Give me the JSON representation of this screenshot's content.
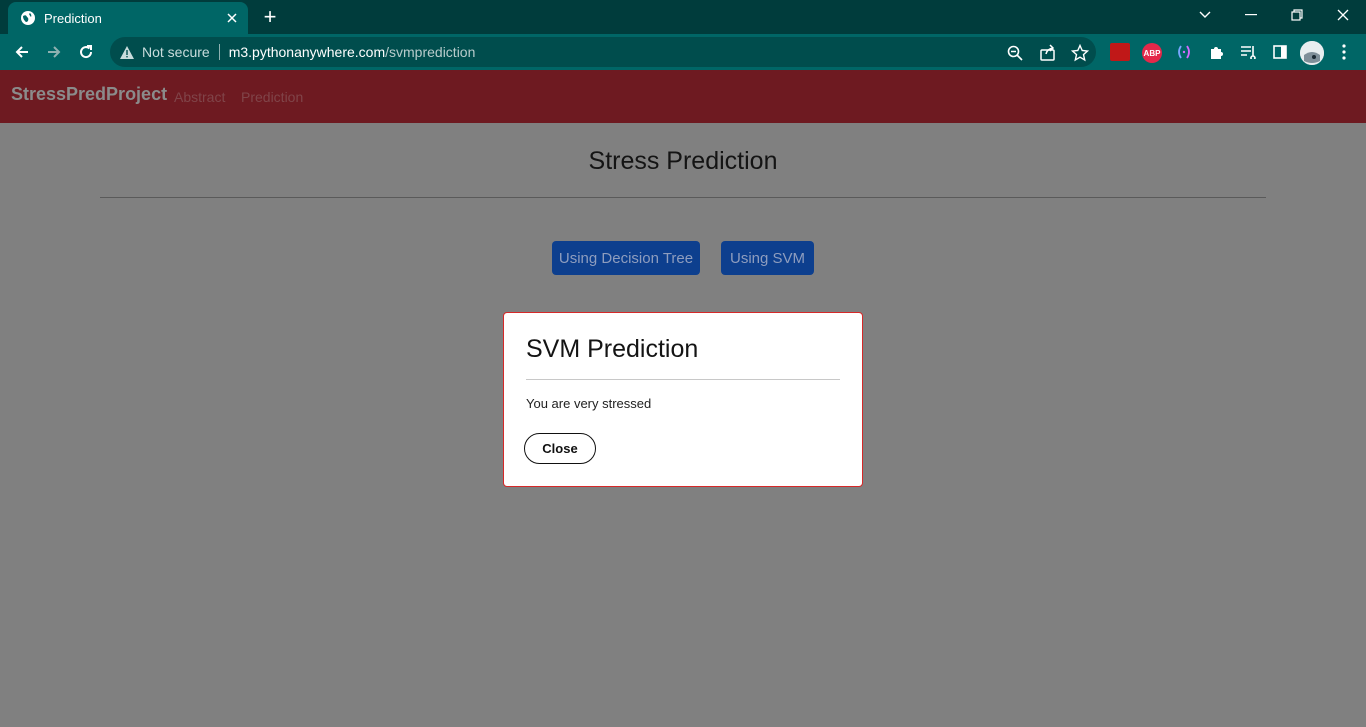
{
  "browser": {
    "tab_title": "Prediction",
    "security_label": "Not secure",
    "url_host": "m3.pythonanywhere.com",
    "url_path": "/svmprediction",
    "extension_abp_label": "ABP"
  },
  "navbar": {
    "brand": "StressPredProject",
    "links": [
      "Abstract",
      "Prediction"
    ]
  },
  "main": {
    "title": "Stress Prediction",
    "buttons": [
      "Using Decision Tree",
      "Using SVM"
    ]
  },
  "modal": {
    "title": "SVM Prediction",
    "message": "You are very stressed",
    "close_label": "Close"
  },
  "colors": {
    "tabbar": "#003c3c",
    "toolbar": "#006666",
    "navbar": "#6e1a21",
    "overlay": "#808080",
    "primary_button": "#0d3f8e",
    "modal_border": "#d62828"
  }
}
